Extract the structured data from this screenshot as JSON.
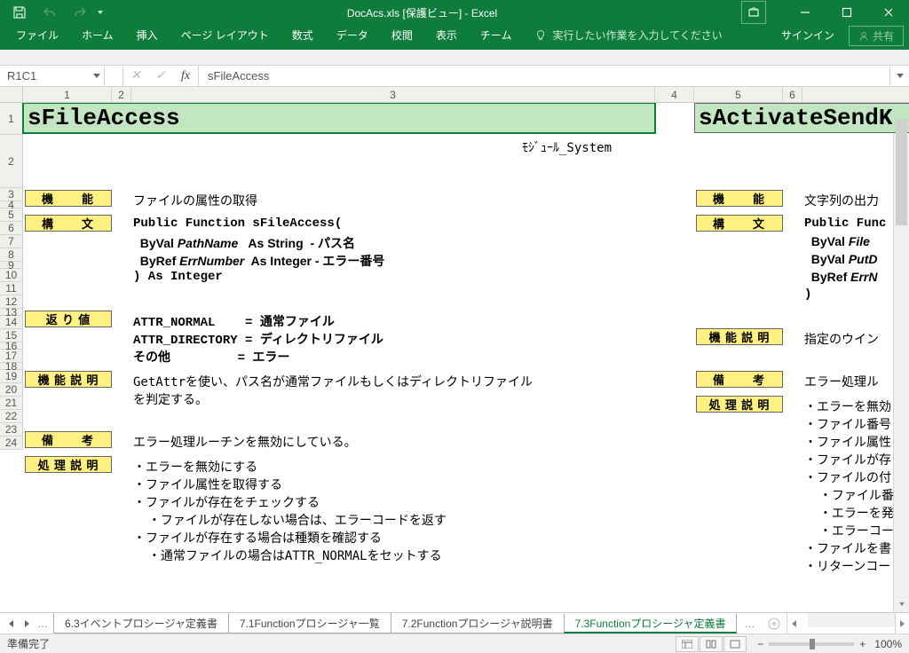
{
  "title": "DocAcs.xls  [保護ビュー] - Excel",
  "menu": {
    "file": "ファイル",
    "home": "ホーム",
    "insert": "挿入",
    "page": "ページ レイアウト",
    "formula": "数式",
    "data": "データ",
    "review": "校閲",
    "view": "表示",
    "team": "チーム",
    "tellme": "実行したい作業を入力してください",
    "signin": "サインイン",
    "share": "共有"
  },
  "namebox": "R1C1",
  "formula": "sFileAccess",
  "columns": {
    "c1": "1",
    "c2": "2",
    "c3": "3",
    "c4": "4",
    "c5": "5",
    "c6": "6"
  },
  "main_title": "sFileAccess",
  "module_label": "ﾓｼﾞｭｰﾙ_System",
  "sec": {
    "kinou": "機　　能",
    "koubun": "構　　文",
    "modori": "返 り 値",
    "kinousetumei": "機 能 説 明",
    "bikou": "備　　考",
    "shori": "処 理 説 明"
  },
  "r3": "ファイルの属性の取得",
  "r5": "Public Function sFileAccess(",
  "r6": "  ByVal PathName   As String  - パス名",
  "r6a": "  ByVal ",
  "r6b": "PathName",
  "r6c": "   As String  - パス名",
  "r7a": "  ByRef ",
  "r7b": "ErrNumber",
  "r7c": "  As Integer - エラー番号",
  "r8": ") As Integer",
  "r10": "ATTR_NORMAL    = 通常ファイル",
  "r11": "ATTR_DIRECTORY = ディレクトリファイル",
  "r12": "その他         = エラー",
  "r14": "GetAttrを使い、パス名が通常ファイルもしくはディレクトリファイル",
  "r15": "を判定する。",
  "r17": "エラー処理ルーチンを無効にしている。",
  "r19": "・エラーを無効にする",
  "r20": "・ファイル属性を取得する",
  "r21": "・ファイルが存在をチェックする",
  "r22": "  ・ファイルが存在しない場合は、エラーコードを返す",
  "r23": "・ファイルが存在する場合は種類を確認する",
  "r24": "  ・通常ファイルの場合はATTR_NORMALをセットする",
  "right_title": "sActivateSendK",
  "right": {
    "r3": "文字列の出力",
    "r5": "Public Func",
    "r6a": "  ByVal ",
    "r6b": "File",
    "r7a": "  ByVal ",
    "r7b": "PutD",
    "r8a": "  ByRef ",
    "r8b": "ErrN",
    "r9": ")",
    "r11": "指定のウイン",
    "r13": "エラー処理ル",
    "r15": "・エラーを無効",
    "r16": "・ファイル番号",
    "r17": "・ファイル属性",
    "r18": "・ファイルが存",
    "r19": "・ファイルの付",
    "r20": "  ・ファイル番",
    "r21": "  ・エラーを発",
    "r22": "  ・エラーコー",
    "r23": "・ファイルを書",
    "r24": "・リターンコー"
  },
  "tabs": {
    "t1": "6.3イベントプロシージャ定義書",
    "t2": "7.1Functionプロシージャ一覧",
    "t3": "7.2Functionプロシージャ説明書",
    "t4": "7.3Functionプロシージャ定義書"
  },
  "status": "準備完了",
  "zoom": "100%"
}
